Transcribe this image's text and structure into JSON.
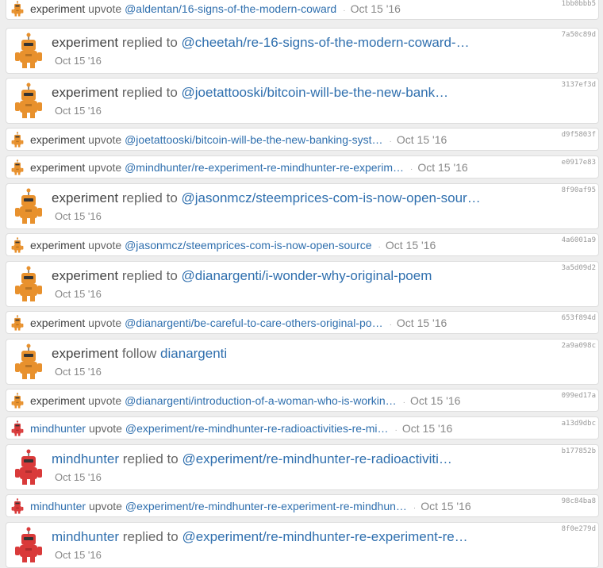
{
  "items": [
    {
      "type": "small",
      "user": "experiment",
      "avatar": "orange-robot",
      "verb": "upvote",
      "link": "@aldentan/16-signs-of-the-modern-coward",
      "date": "Oct 15 '16",
      "hash": "1bb0bbb5"
    },
    {
      "type": "big",
      "user": "experiment",
      "avatar": "orange-robot",
      "verb": "replied to",
      "link": "@cheetah/re-16-signs-of-the-modern-coward-…",
      "date": "Oct 15 '16",
      "hash": "7a50c89d"
    },
    {
      "type": "big",
      "user": "experiment",
      "avatar": "orange-robot",
      "verb": "replied to",
      "link": "@joetattooski/bitcoin-will-be-the-new-bank…",
      "date": "Oct 15 '16",
      "hash": "3137ef3d"
    },
    {
      "type": "small",
      "user": "experiment",
      "avatar": "orange-robot",
      "verb": "upvote",
      "link": "@joetattooski/bitcoin-will-be-the-new-banking-syst…",
      "date": "Oct 15 '16",
      "hash": "d9f5803f"
    },
    {
      "type": "small",
      "user": "experiment",
      "avatar": "orange-robot",
      "verb": "upvote",
      "link": "@mindhunter/re-experiment-re-mindhunter-re-experim…",
      "date": "Oct 15 '16",
      "hash": "e0917e83"
    },
    {
      "type": "big",
      "user": "experiment",
      "avatar": "orange-robot",
      "verb": "replied to",
      "link": "@jasonmcz/steemprices-com-is-now-open-sour…",
      "date": "Oct 15 '16",
      "hash": "8f90af95"
    },
    {
      "type": "small",
      "user": "experiment",
      "avatar": "orange-robot",
      "verb": "upvote",
      "link": "@jasonmcz/steemprices-com-is-now-open-source",
      "date": "Oct 15 '16",
      "hash": "4a6001a9"
    },
    {
      "type": "big",
      "user": "experiment",
      "avatar": "orange-robot",
      "verb": "replied to",
      "link": "@dianargenti/i-wonder-why-original-poem",
      "date": "Oct 15 '16",
      "hash": "3a5d09d2"
    },
    {
      "type": "small",
      "user": "experiment",
      "avatar": "orange-robot",
      "verb": "upvote",
      "link": "@dianargenti/be-careful-to-care-others-original-po…",
      "date": "Oct 15 '16",
      "hash": "653f894d"
    },
    {
      "type": "big",
      "user": "experiment",
      "avatar": "orange-robot",
      "verb": "follow",
      "link": "dianargenti",
      "date": "Oct 15 '16",
      "hash": "2a9a098c"
    },
    {
      "type": "small",
      "user": "experiment",
      "avatar": "orange-robot",
      "verb": "upvote",
      "link": "@dianargenti/introduction-of-a-woman-who-is-workin…",
      "date": "Oct 15 '16",
      "hash": "099ed17a"
    },
    {
      "type": "small",
      "user": "mindhunter",
      "avatar": "red-robot",
      "verb": "upvote",
      "link": "@experiment/re-mindhunter-re-radioactivities-re-mi…",
      "date": "Oct 15 '16",
      "hash": "a13d9dbc"
    },
    {
      "type": "big",
      "user": "mindhunter",
      "avatar": "red-robot",
      "verb": "replied to",
      "link": "@experiment/re-mindhunter-re-radioactiviti…",
      "date": "Oct 15 '16",
      "hash": "b177852b"
    },
    {
      "type": "small",
      "user": "mindhunter",
      "avatar": "red-robot",
      "verb": "upvote",
      "link": "@experiment/re-mindhunter-re-experiment-re-mindhun…",
      "date": "Oct 15 '16",
      "hash": "98c84ba8"
    },
    {
      "type": "big",
      "user": "mindhunter",
      "avatar": "red-robot",
      "verb": "replied to",
      "link": "@experiment/re-mindhunter-re-experiment-re…",
      "date": "Oct 15 '16",
      "hash": "8f0e279d"
    }
  ],
  "colors": {
    "orange-robot": "#e8912d",
    "red-robot": "#d93a3a",
    "link": "#2f6fae"
  }
}
